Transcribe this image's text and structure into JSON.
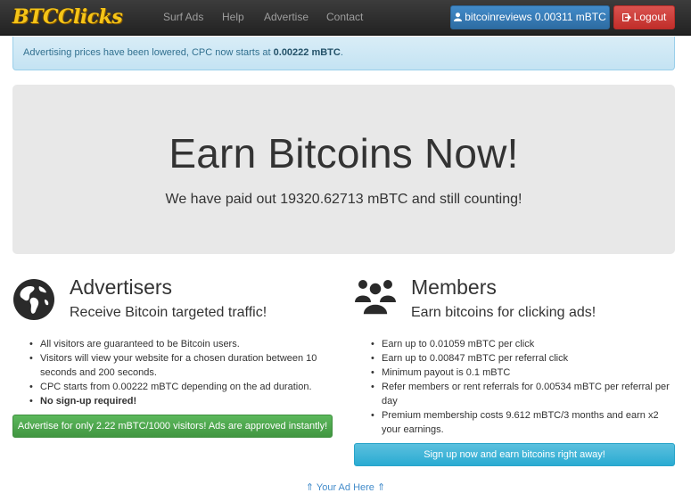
{
  "navbar": {
    "logo": "BTCClicks",
    "links": [
      "Surf Ads",
      "Help",
      "Advertise",
      "Contact"
    ],
    "user_button": "bitcoinreviews 0.00311 mBTC",
    "logout_button": "Logout"
  },
  "alert": {
    "text": "Advertising prices have been lowered, CPC now starts at ",
    "highlight": "0.00222 mBTC",
    "suffix": "."
  },
  "jumbotron": {
    "title": "Earn Bitcoins Now!",
    "subtitle": "We have paid out 19320.62713 mBTC and still counting!"
  },
  "advertisers": {
    "icon": "globe-icon",
    "title": "Advertisers",
    "subtitle": "Receive Bitcoin targeted traffic!",
    "items": [
      "All visitors are guaranteed to be Bitcoin users.",
      "Visitors will view your website for a chosen duration between 10 seconds and 200 seconds.",
      "CPC starts from 0.00222 mBTC depending on the ad duration.",
      "No sign-up required!"
    ],
    "button": "Advertise for only 2.22 mBTC/1000 visitors! Ads are approved instantly!"
  },
  "members": {
    "icon": "users-icon",
    "title": "Members",
    "subtitle": "Earn bitcoins for clicking ads!",
    "items": [
      "Earn up to 0.01059 mBTC per click",
      "Earn up to 0.00847 mBTC per referral click",
      "Minimum payout is 0.1 mBTC",
      "Refer members or rent referrals for 0.00534 mBTC per referral per day",
      "Premium membership costs 9.612 mBTC/3 months and earn x2 your earnings."
    ],
    "button": "Sign up now and earn bitcoins right away!"
  },
  "ad_link": "⇑ Your Ad Here ⇑"
}
